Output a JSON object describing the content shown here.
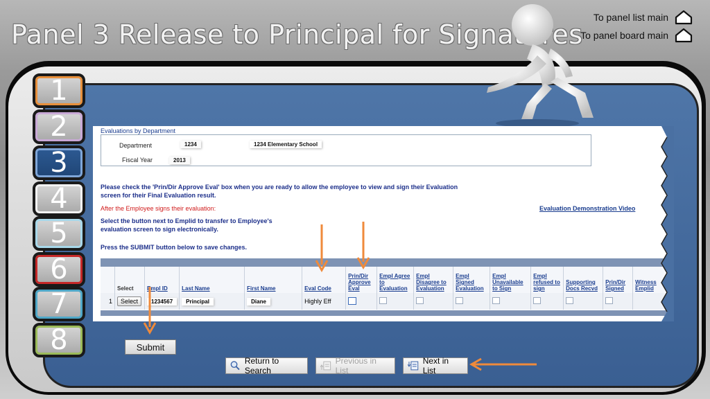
{
  "slide": {
    "title": "Panel 3 Release to Principal for Signatures",
    "links": [
      {
        "label": "To panel list main",
        "icon": "home-icon"
      },
      {
        "label": "To panel board main",
        "icon": "home-icon"
      }
    ],
    "tabs": [
      "1",
      "2",
      "3",
      "4",
      "5",
      "6",
      "7",
      "8"
    ],
    "active_tab": "3",
    "colors": {
      "accent": "#ef8a3b",
      "board_blue": "#3a5f92",
      "link_blue": "#1a3d8f",
      "warning_red": "#d01a1a"
    }
  },
  "form": {
    "section_title": "Evaluations by Department",
    "department_label": "Department",
    "department_id": "1234",
    "department_name": "1234 Elementary School",
    "fiscal_year_label": "Fiscal Year",
    "fiscal_year": "2013",
    "instruction_1a": "Please check the 'Prin/Dir Approve Eval' box when you are ready to allow the employee to view and sign their Evaluation",
    "instruction_1b": "screen for their Final Evaluation result.",
    "warning": "After the Employee signs their evaluation:",
    "demo_link": "Evaluation Demonstration Video",
    "instruction_2a": "Select the button next to Emplid to transfer to Employee's",
    "instruction_2b": "evaluation screen to sign electronically.",
    "instruction_3": "Press the SUBMIT button below to save changes."
  },
  "grid": {
    "columns": [
      "Select",
      "Empl ID",
      "Last Name",
      "First Name",
      "Eval Code",
      "Prin/Dir Approve Eval",
      "Empl Agree to Evaluation",
      "Empl Disagree to Evaluation",
      "Empl Signed Evaluation",
      "Empl Unavailable to Sign",
      "Empl refused to sign",
      "Supporting Docs Recvd",
      "Prin/Dir Signed",
      "Witness Emplid"
    ],
    "rows": [
      {
        "row_num": "1",
        "select_label": "Select",
        "empl_id": "1234567",
        "last_name": "Principal",
        "first_name": "Diane",
        "eval_code": "Highly Eff"
      }
    ]
  },
  "buttons": {
    "submit": "Submit",
    "return_to_search": "Return to Search",
    "previous_in_list": "Previous in List",
    "next_in_list": "Next in List"
  }
}
